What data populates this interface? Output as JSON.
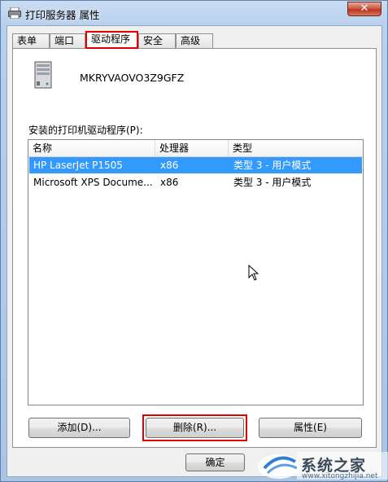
{
  "window": {
    "title": "打印服务器 属性",
    "close_glyph": "✕"
  },
  "tabs": [
    {
      "label": "表单",
      "active": false
    },
    {
      "label": "端口",
      "active": false
    },
    {
      "label": "驱动程序",
      "active": true
    },
    {
      "label": "安全",
      "active": false
    },
    {
      "label": "高级",
      "active": false
    }
  ],
  "server": {
    "name": "MKRYVAOVO3Z9GFZ",
    "icon": "server-icon"
  },
  "drivers": {
    "label": "安装的打印机驱动程序(P):",
    "columns": [
      "名称",
      "处理器",
      "类型"
    ],
    "rows": [
      {
        "name": "HP LaserJet P1505",
        "processor": "x86",
        "type": "类型 3 - 用户模式",
        "selected": true
      },
      {
        "name": "Microsoft XPS Docume...",
        "processor": "x86",
        "type": "类型 3 - 用户模式",
        "selected": false
      }
    ]
  },
  "buttons": {
    "add": "添加(D)...",
    "remove": "删除(R)...",
    "properties": "属性(E)",
    "ok": "确定"
  },
  "watermark": {
    "text": "系统之家",
    "sub": "www.xitongzhijia.net"
  },
  "colors": {
    "selection": "#3399ff",
    "highlight_box": "#e00000"
  }
}
